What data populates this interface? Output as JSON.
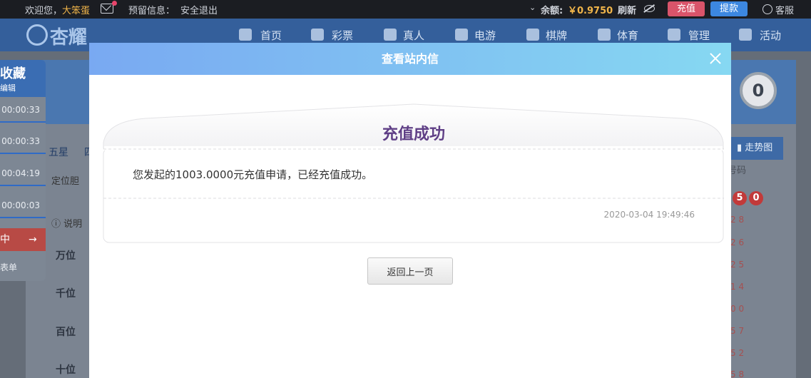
{
  "topbar": {
    "welcome": "欢迎您，",
    "username": "大笨蛋",
    "reserved": "预留信息：",
    "logout": "安全退出",
    "balance_label": "余额:",
    "balance_amount": "￥0.9750",
    "refresh": "刷新",
    "recharge": "充值",
    "withdraw": "提款",
    "service": "客服"
  },
  "brand": {
    "logo_text": "杏耀"
  },
  "nav": {
    "items": [
      {
        "label": "首页",
        "icon": "home-icon"
      },
      {
        "label": "彩票",
        "icon": "ticket-icon"
      },
      {
        "label": "真人",
        "icon": "person-icon"
      },
      {
        "label": "电游",
        "icon": "arcade-icon"
      },
      {
        "label": "棋牌",
        "icon": "cards-icon"
      },
      {
        "label": "体育",
        "icon": "trophy-icon"
      },
      {
        "label": "管理",
        "icon": "users-icon"
      },
      {
        "label": "活动",
        "icon": "gift-icon"
      }
    ]
  },
  "background": {
    "fav_title": "收藏",
    "fav_sub": "编辑",
    "fav_times": [
      "00:00:33",
      "00:00:33",
      "00:04:19",
      "00:00:03"
    ],
    "fav_red": "中",
    "fav_list": "表单",
    "tab_wx": "五星",
    "tab_partial": "四",
    "loc_label": "定位胆",
    "note_label": "说明",
    "positions": [
      "万位",
      "千位",
      "百位",
      "十位"
    ],
    "counter": "0",
    "trend": "走势图",
    "trend_col": "号码",
    "balls": [
      "5",
      "0"
    ],
    "trend_nums": [
      "2 8",
      "2 6",
      "2 5",
      "1 4",
      "0 0",
      "5 7",
      "5 2",
      "5 8"
    ]
  },
  "modal": {
    "title": "查看站内信",
    "card_title": "充值成功",
    "message": "您发起的1003.0000元充值申请，已经充值成功。",
    "time": "2020-03-04 19:49:46",
    "back_button": "返回上一页"
  },
  "colors": {
    "header_start": "#79a9f2",
    "header_end": "#86d8f2",
    "title_purple": "#5f3f86",
    "balance": "#f0b54a",
    "recharge": "#d9546a",
    "withdraw": "#3c87e0"
  }
}
